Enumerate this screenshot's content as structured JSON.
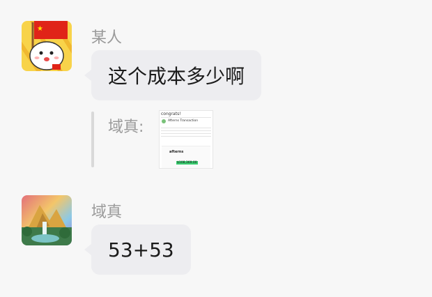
{
  "messages": [
    {
      "sender": "某人",
      "text": "这个成本多少啊",
      "avatar": "red-flag-mascot-avatar"
    },
    {
      "sender": "域真",
      "text": "53+53",
      "avatar": "landscape-painting-avatar"
    }
  ],
  "quote": {
    "label": "域真:",
    "thumbnail": {
      "header": "congrats!",
      "title": "Afterns Transaction",
      "logo": "afterns",
      "amount": "$108,369.00"
    }
  },
  "colors": {
    "background": "#f7f7f7",
    "bubble": "#ededf0",
    "sender_text": "#9a9a9a"
  }
}
